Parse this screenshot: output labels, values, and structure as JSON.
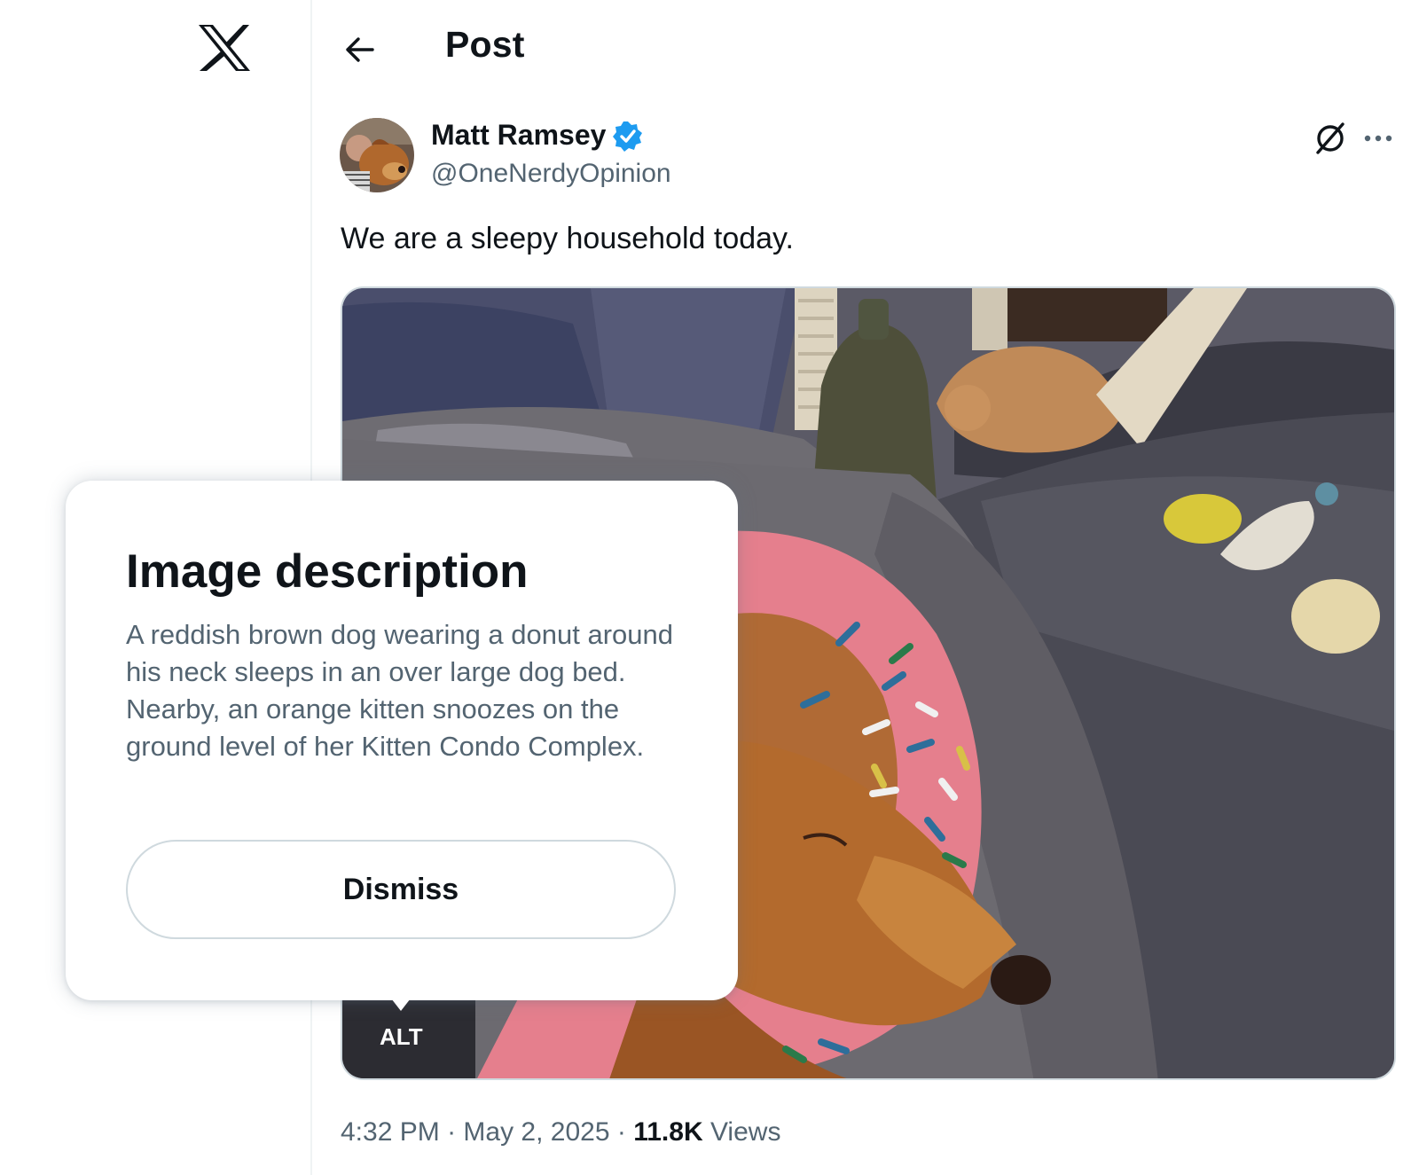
{
  "header": {
    "title": "Post"
  },
  "post": {
    "author_name": "Matt Ramsey",
    "author_handle": "@OneNerdyOpinion",
    "text": "We are a sleepy household today.",
    "media": {
      "alt_badge": "ALT"
    },
    "time": "4:32 PM",
    "separator": "·",
    "date": "May 2, 2025",
    "views_count": "11.8K",
    "views_label": "Views"
  },
  "popover": {
    "title": "Image description",
    "body": "A reddish brown dog wearing a donut around his neck sleeps in an over large dog bed. Nearby, an orange kitten snoozes on the ground level of her Kitten Condo Complex.",
    "dismiss_label": "Dismiss"
  },
  "colors": {
    "text_primary": "#0f1419",
    "text_secondary": "#536471",
    "verified_blue": "#1d9bf0",
    "border": "#cfd9de"
  },
  "icons": [
    "x-logo-icon",
    "back-arrow-icon",
    "verified-badge-icon",
    "grok-icon",
    "more-icon"
  ]
}
